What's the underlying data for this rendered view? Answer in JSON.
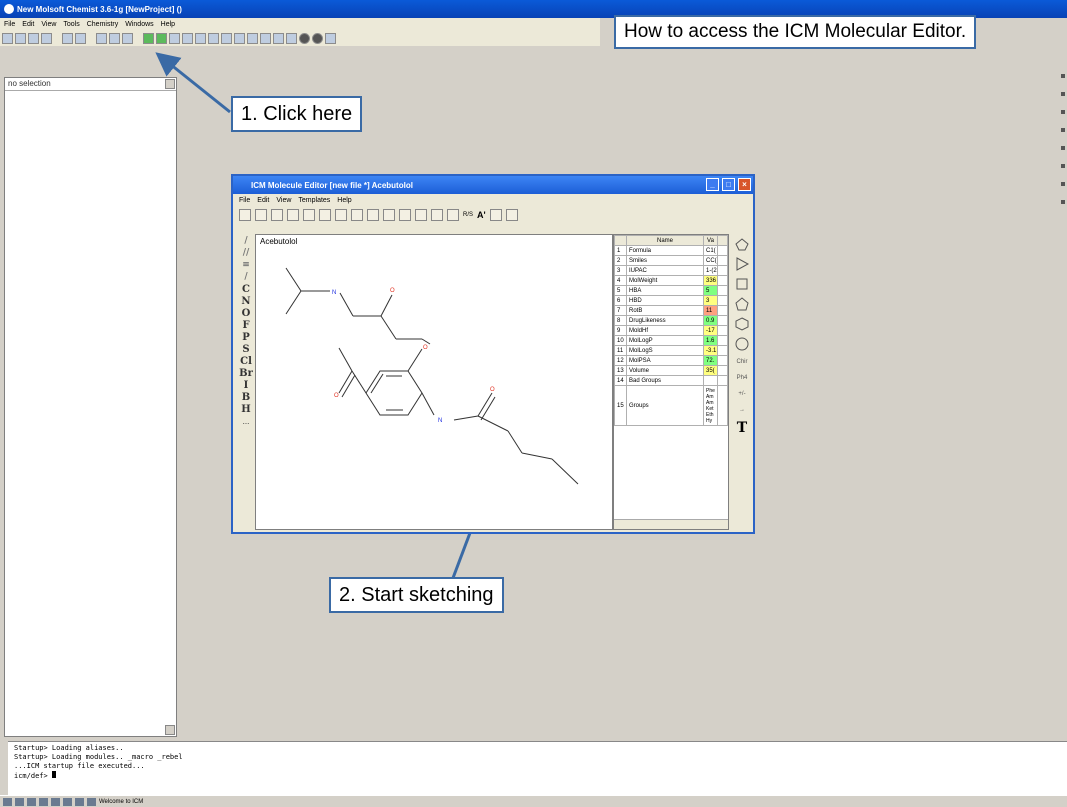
{
  "main_window": {
    "title": "New Molsoft Chemist 3.6-1g [NewProject] ()",
    "menu": [
      "File",
      "Edit",
      "View",
      "Tools",
      "Chemistry",
      "Windows",
      "Help"
    ]
  },
  "left_panel": {
    "selection": "no selection"
  },
  "callouts": {
    "header": "How to access the ICM Molecular Editor.",
    "step1": "1. Click here",
    "step2": "2. Start sketching"
  },
  "editor": {
    "title": "ICM Molecule Editor [new file *] Acebutolol",
    "menu": [
      "File",
      "Edit",
      "View",
      "Templates",
      "Help"
    ],
    "molecule_name": "Acebutolol",
    "element_tools": [
      "C",
      "N",
      "O",
      "F",
      "P",
      "S",
      "Cl",
      "Br",
      "I",
      "B",
      "H",
      "..."
    ],
    "toolbar_labels": {
      "rs": "R/S",
      "font": "A'"
    },
    "shape_labels": {
      "chiral": "Chir",
      "phenyl": "Ph4",
      "plus_minus": "+/-",
      "text": "T"
    },
    "properties": {
      "headers": {
        "name": "Name",
        "value": "Va"
      },
      "rows": [
        {
          "n": "1",
          "name": "Formula",
          "value": "C1("
        },
        {
          "n": "2",
          "name": "Smiles",
          "value": "CC("
        },
        {
          "n": "3",
          "name": "IUPAC",
          "value": "1-(2"
        },
        {
          "n": "4",
          "name": "MolWeight",
          "value": "336",
          "color": "#ffff80"
        },
        {
          "n": "5",
          "name": "HBA",
          "value": "5",
          "color": "#80ff80"
        },
        {
          "n": "6",
          "name": "HBD",
          "value": "3",
          "color": "#ffff80"
        },
        {
          "n": "7",
          "name": "RotB",
          "value": "11",
          "color": "#ffa080"
        },
        {
          "n": "8",
          "name": "DrugLikeness",
          "value": "0.9",
          "color": "#80ff80"
        },
        {
          "n": "9",
          "name": "MoldHf",
          "value": "-17",
          "color": "#ffff80"
        },
        {
          "n": "10",
          "name": "MolLogP",
          "value": "1.6",
          "color": "#80ff80"
        },
        {
          "n": "11",
          "name": "MolLogS",
          "value": "-3.1",
          "color": "#ffff80"
        },
        {
          "n": "12",
          "name": "MolPSA",
          "value": "72.",
          "color": "#80ff80"
        },
        {
          "n": "13",
          "name": "Volume",
          "value": "35(",
          "color": "#ffff80"
        },
        {
          "n": "14",
          "name": "Bad Groups",
          "value": ""
        },
        {
          "n": "15",
          "name": "Groups",
          "value": "Phe Am Am Ket Eth Hy"
        }
      ]
    }
  },
  "console": {
    "lines": [
      "Startup> Loading aliases..",
      "Startup> Loading modules.. _macro _rebel",
      "...ICM startup file executed...",
      "icm/def>"
    ]
  },
  "statusbar": {
    "text": "Welcome to ICM"
  },
  "colors": {
    "title_blue": "#0a5ad8",
    "callout_border": "#3a6aa5",
    "arrow": "#3a6aa5",
    "oxygen": "#e03020",
    "nitrogen": "#2030e0"
  }
}
